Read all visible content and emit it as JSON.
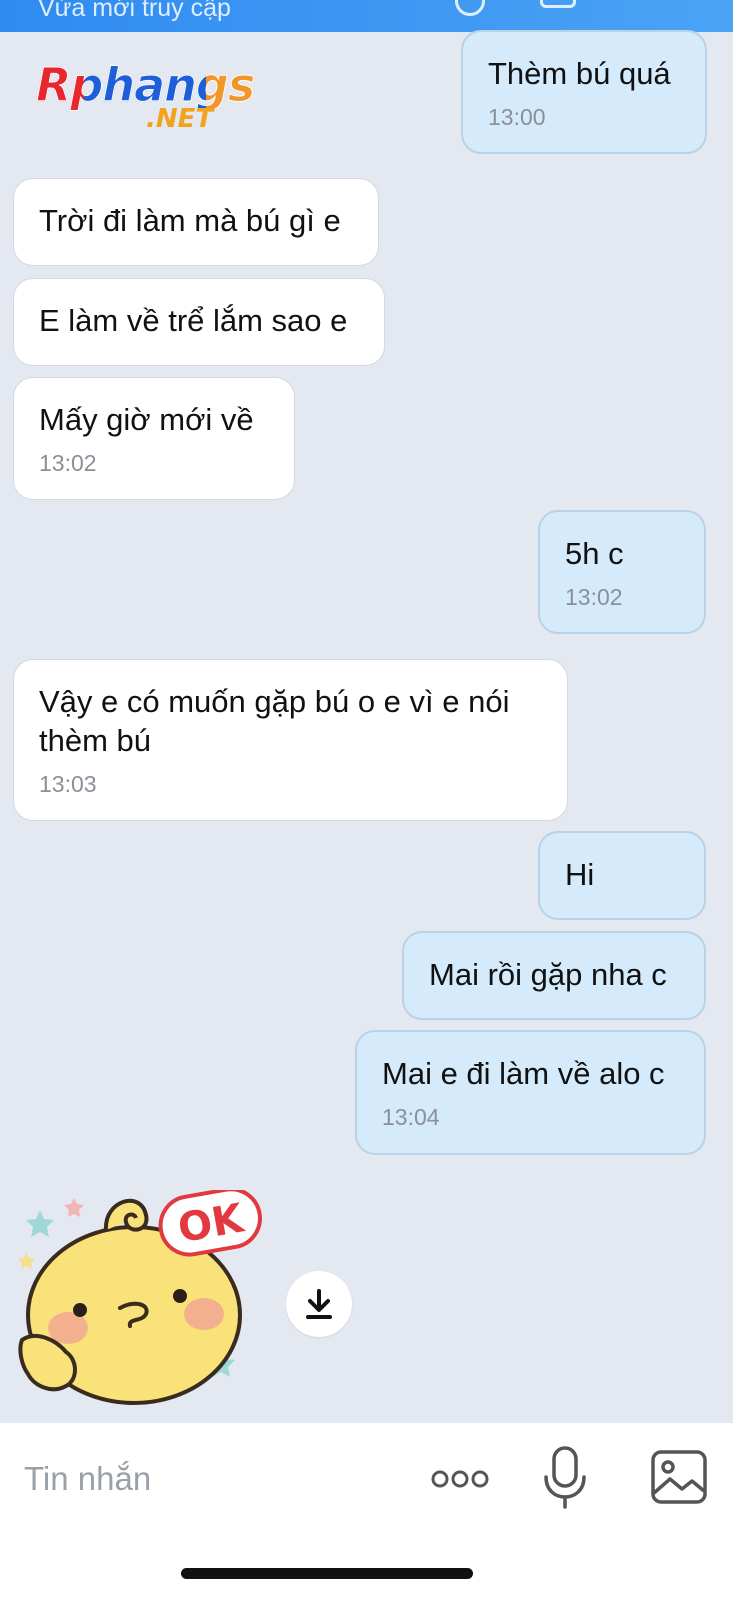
{
  "header": {
    "status_text": "Vừa mới truy cập"
  },
  "watermark": {
    "brand": "Rphangs",
    "tld": ".NET"
  },
  "messages": [
    {
      "dir": "out",
      "text": "Thèm bú quá",
      "time": "13:00"
    },
    {
      "dir": "in",
      "text": "Trời đi làm mà bú gì e"
    },
    {
      "dir": "in",
      "text": "E làm về trể lắm sao e"
    },
    {
      "dir": "in",
      "text": "Mấy giờ mới về",
      "time": "13:02"
    },
    {
      "dir": "out",
      "text": "5h c",
      "time": "13:02"
    },
    {
      "dir": "in",
      "text": "Vậy e có muốn gặp bú o e vì e nói thèm bú",
      "time": "13:03"
    },
    {
      "dir": "out",
      "text": "Hi"
    },
    {
      "dir": "out",
      "text": "Mai rồi gặp nha c"
    },
    {
      "dir": "out",
      "text": "Mai e đi làm về alo c",
      "time": "13:04"
    }
  ],
  "sticker": {
    "label": "OK"
  },
  "icons": {
    "download": "download-icon",
    "more": "more-dots-icon",
    "mic": "microphone-icon",
    "image": "image-icon"
  },
  "composer": {
    "placeholder": "Tin nhắn"
  },
  "colors": {
    "background": "#e4e8f1",
    "incoming_bubble": "#ffffff",
    "outgoing_bubble": "#d5ebfb",
    "header": "#2f8bf0"
  }
}
